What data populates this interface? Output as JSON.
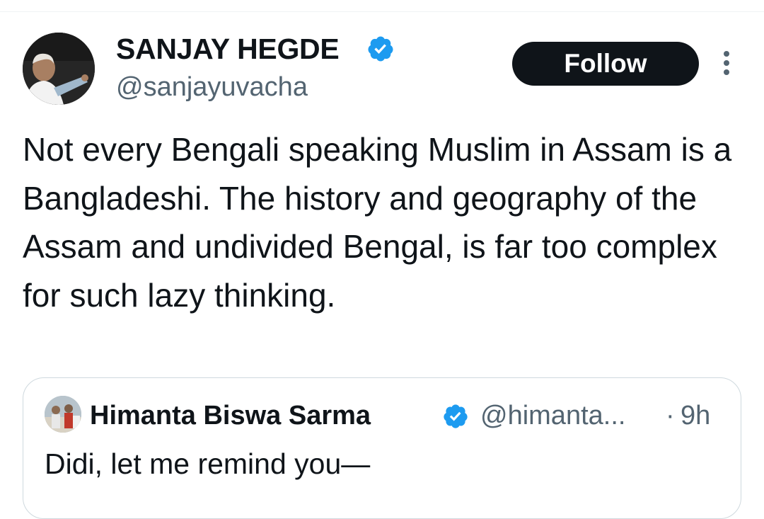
{
  "author": {
    "display_name": "SANJAY HEGDE",
    "handle": "@sanjayuvacha",
    "verified": true,
    "avatar_icon": "avatar-photo"
  },
  "actions": {
    "follow_label": "Follow",
    "more_icon": "more-vertical-icon"
  },
  "tweet": {
    "text": "Not every Bengali speaking Muslim in Assam is a Bangladeshi. The history and geography of the Assam and undivided Bengal, is far too complex for such lazy thinking."
  },
  "quoted_tweet": {
    "display_name": "Himanta Biswa Sarma",
    "handle": "@himanta...",
    "separator": "·",
    "time": "9h",
    "verified": true,
    "text": "Didi, let me remind you—"
  },
  "colors": {
    "text": "#0f1419",
    "secondary": "#536471",
    "verified": "#1d9bf0",
    "follow_bg": "#0f1419",
    "border": "#cfd9de"
  }
}
